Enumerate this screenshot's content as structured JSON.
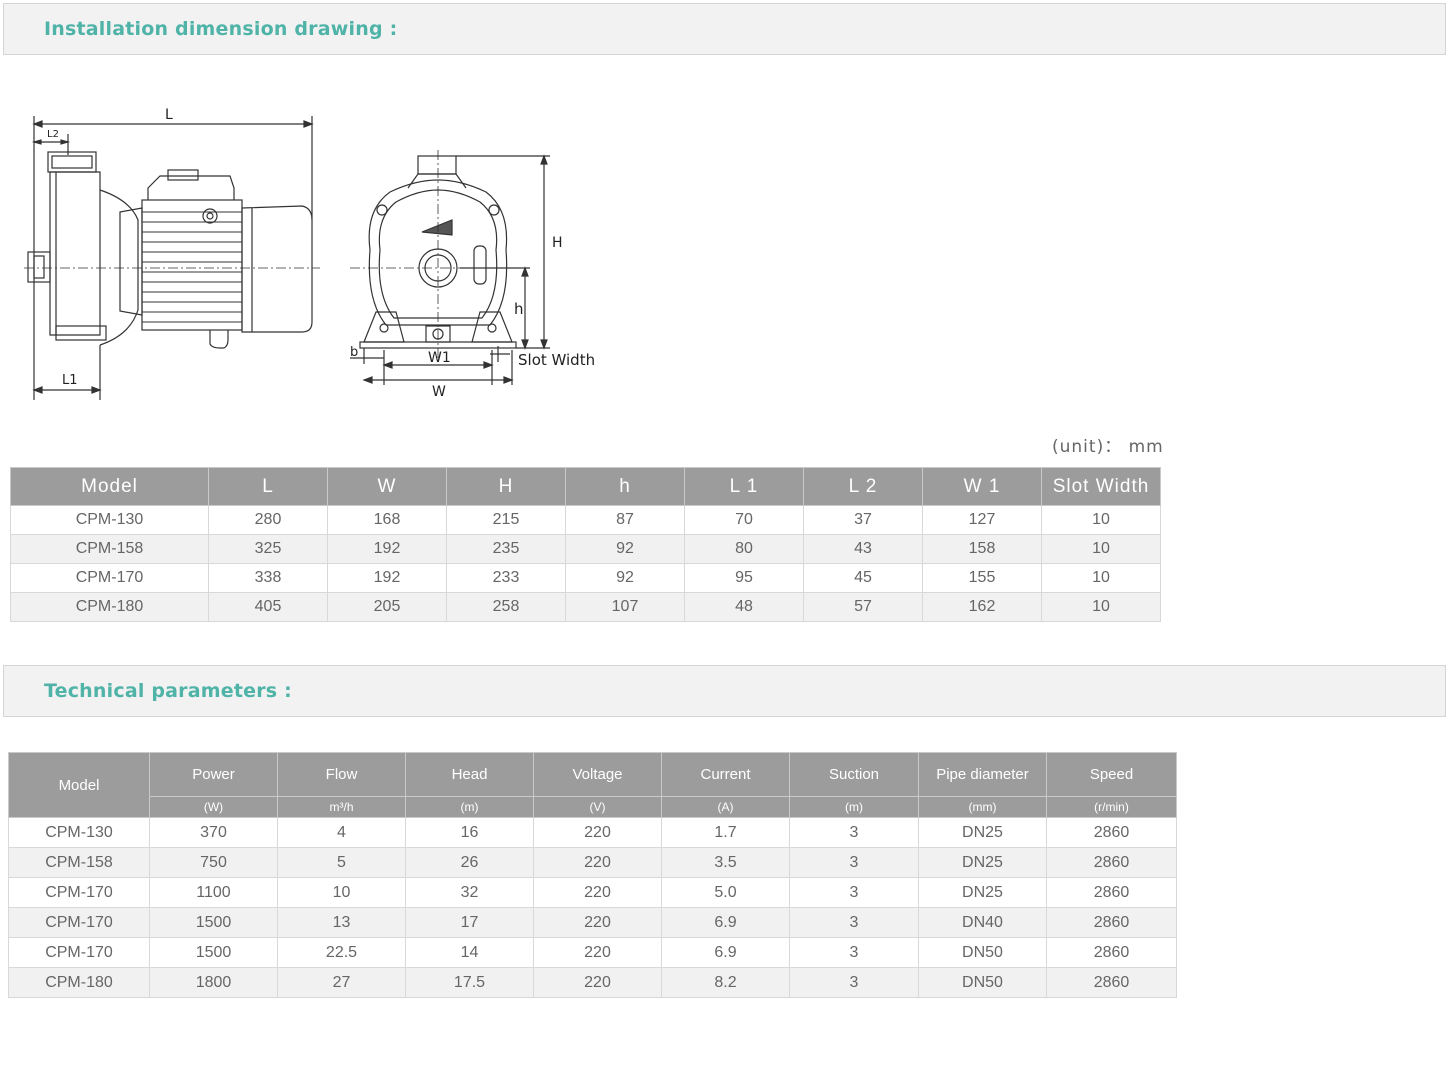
{
  "sections": {
    "installation_title": "Installation dimension drawing :",
    "technical_title": "Technical parameters :"
  },
  "drawing": {
    "labels": {
      "L": "L",
      "L2": "L2",
      "L1": "L1",
      "H": "H",
      "h": "h",
      "b": "b",
      "W1": "W1",
      "W": "W",
      "slot_width": "Slot Width"
    }
  },
  "unit_label": "(unit)： mm",
  "dimensions": {
    "headers": [
      "Model",
      "L",
      "W",
      "H",
      "h",
      "L 1",
      "L 2",
      "W 1",
      "Slot Width"
    ],
    "rows": [
      [
        "CPM-130",
        "280",
        "168",
        "215",
        "87",
        "70",
        "37",
        "127",
        "10"
      ],
      [
        "CPM-158",
        "325",
        "192",
        "235",
        "92",
        "80",
        "43",
        "158",
        "10"
      ],
      [
        "CPM-170",
        "338",
        "192",
        "233",
        "92",
        "95",
        "45",
        "155",
        "10"
      ],
      [
        "CPM-180",
        "405",
        "205",
        "258",
        "107",
        "48",
        "57",
        "162",
        "10"
      ]
    ]
  },
  "technical": {
    "model_header": "Model",
    "headers": [
      "Power",
      "Flow",
      "Head",
      "Voltage",
      "Current",
      "Suction",
      "Pipe diameter",
      "Speed"
    ],
    "units": [
      "(W)",
      "m³/h",
      "(m)",
      "(V)",
      "(A)",
      "(m)",
      "(mm)",
      "(r/min)"
    ],
    "rows": [
      [
        "CPM-130",
        "370",
        "4",
        "16",
        "220",
        "1.7",
        "3",
        "DN25",
        "2860"
      ],
      [
        "CPM-158",
        "750",
        "5",
        "26",
        "220",
        "3.5",
        "3",
        "DN25",
        "2860"
      ],
      [
        "CPM-170",
        "1100",
        "10",
        "32",
        "220",
        "5.0",
        "3",
        "DN25",
        "2860"
      ],
      [
        "CPM-170",
        "1500",
        "13",
        "17",
        "220",
        "6.9",
        "3",
        "DN40",
        "2860"
      ],
      [
        "CPM-170",
        "1500",
        "22.5",
        "14",
        "220",
        "6.9",
        "3",
        "DN50",
        "2860"
      ],
      [
        "CPM-180",
        "1800",
        "27",
        "17.5",
        "220",
        "8.2",
        "3",
        "DN50",
        "2860"
      ]
    ]
  }
}
